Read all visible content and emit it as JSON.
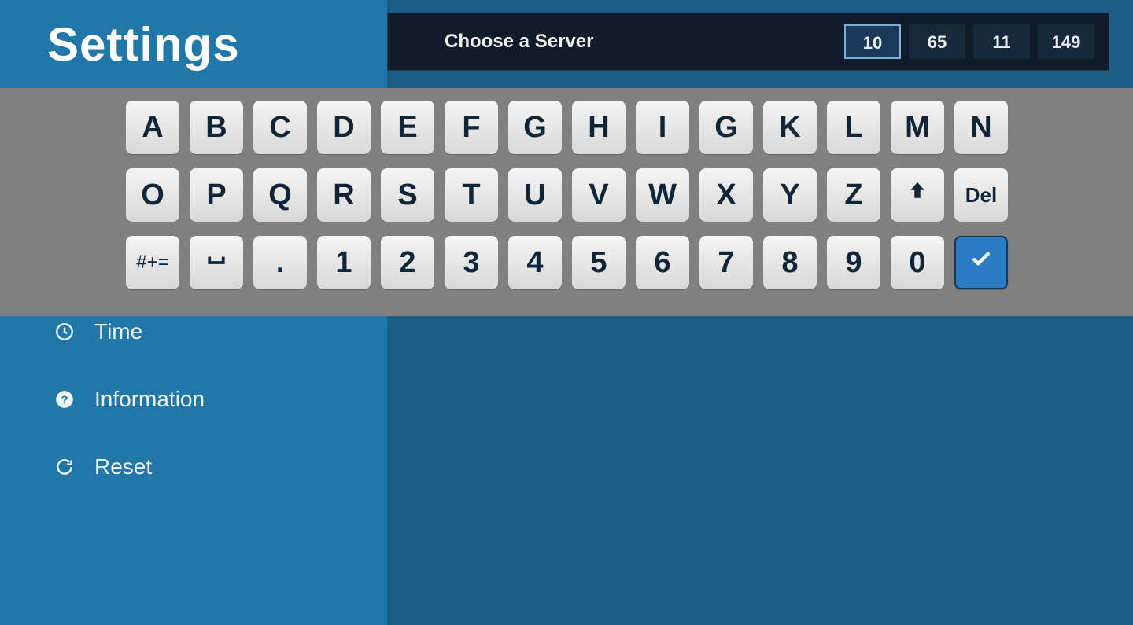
{
  "title": "Settings",
  "topbar": {
    "prompt": "Choose a Server",
    "ip": [
      "10",
      "65",
      "11",
      "149"
    ],
    "selected_index": 0
  },
  "sidebar": {
    "items": [
      {
        "icon": "clock-icon",
        "label": "Time"
      },
      {
        "icon": "help-icon",
        "label": "Information"
      },
      {
        "icon": "refresh-icon",
        "label": "Reset"
      }
    ]
  },
  "keyboard": {
    "row1": [
      "A",
      "B",
      "C",
      "D",
      "E",
      "F",
      "G",
      "H",
      "I",
      "G",
      "K",
      "L",
      "M",
      "N"
    ],
    "row2": [
      "O",
      "P",
      "Q",
      "R",
      "S",
      "T",
      "U",
      "V",
      "W",
      "X",
      "Y",
      "Z"
    ],
    "row2_shift_icon": "arrow-up-icon",
    "row2_del": "Del",
    "row3_symbols": "#+=",
    "row3_space_icon": "space-icon",
    "row3_dot": ".",
    "row3_digits": [
      "1",
      "2",
      "3",
      "4",
      "5",
      "6",
      "7",
      "8",
      "9",
      "0"
    ],
    "row3_confirm_icon": "check-icon"
  }
}
